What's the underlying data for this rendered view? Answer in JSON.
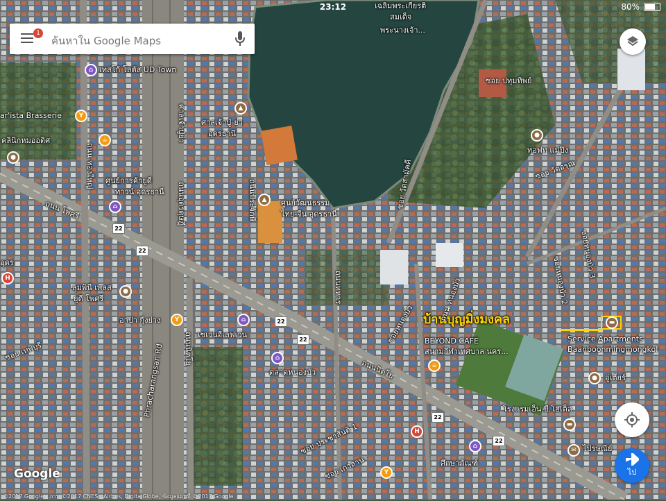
{
  "status_bar": {
    "time": "23:12",
    "battery": "80%",
    "battery_level": 0.8
  },
  "search": {
    "placeholder": "ค้นหาใน Google Maps",
    "notification_count": "1"
  },
  "map_labels": {
    "lake_name_line1": "เฉลิมพระเกียรติ",
    "lake_name_line2": "สมเด็จ",
    "lake_name_line3": "พระนางเจ้า...",
    "tesco": "เทสโก้ โลตัส UD Town",
    "barista": "ar'ista Brasserie",
    "clinic": "คลินิกหมออดิศ",
    "shrine_line1": "ศาลเจ้าปู่-ย่า",
    "shrine_line2": "อุดรธานี",
    "ud_center_line1": "ศูนย์การค้ายูดี",
    "ud_center_line2": "ทาวน์ อุดรธานี",
    "culture_line1": "ศูนย์วัฒนธรรม",
    "culture_line2": "ไทย-จีน อุดรธานี",
    "lumphini_line1": "ลุมพินี เพลส",
    "lumphini_line2": "ยูดี โพศรี",
    "arpa": "อาปา กุ้งย่าง",
    "seven": "เซเว่นอีเลฟเว่น",
    "market": "ตลาดหนองบัว",
    "beyond": "BEYOND CAFE",
    "stadium": "สนามกีฬาเทศบาล นคร...",
    "hotel_thai": "บ้านบุญมิ่งมงคล",
    "service_line1": "Service Apartments",
    "service_line2": "Baanboonmingmongkol",
    "ut_tier": "อู่เตียร์",
    "n_b_hotel": "โรงแรมเอ็น.บี.โฮเต็ล",
    "prasanee": "ไปรษณีย์",
    "suksaphan": "ศึกษาภัณฑ์",
    "tiramisu": "ทอฟท แม่ปิง",
    "udon": "อุดร",
    "road_posri": "ถนน โพศรี",
    "road_thongyai": "ถนน ทองใหญ่",
    "road_thanon_tahaan": "ถนนทหาร",
    "road_udon_dusadee": "ถนนอุดรดุษฎี",
    "road_prachak": "ถนนประจักษ์",
    "road_sanlamjo": "ศาลเจ้าปู่ย่า",
    "road_charangsan": "Phracharangsan Rd",
    "road_nitayo": "ถนนนิตโย",
    "road_prachasan": "ซอย ประชาสันติ 1",
    "road_kaolan": "ซอย เกาลาน",
    "road_nongbua1": "ซอยหนองบัว",
    "road_thepburi": "ซอย เทพบุรี",
    "road_pathum": "ซอย ปทุมทิพย์",
    "road_watarang": "ซอย วัดอรุณ",
    "road_nongbua3": "ซอยหนองบัว 3",
    "road_nongbua2": "ซอยหนองบัว 2",
    "road_sanamkila": "ถนน หนองบัว",
    "road_watsamak": "ซอย วัดสามัคคี",
    "route_22": "22",
    "nav_label": "ไป"
  },
  "footer": {
    "google": "Google",
    "copyright": "©2017 Google - ภาพ ©2017 CNES / Airbus, DigitalGlobe, ข้อมูลแผนที่ ©2017 Google"
  },
  "colors": {
    "accent_blue": "#1a73e8",
    "annotation_yellow": "#ffd400",
    "lake": "#254640"
  }
}
